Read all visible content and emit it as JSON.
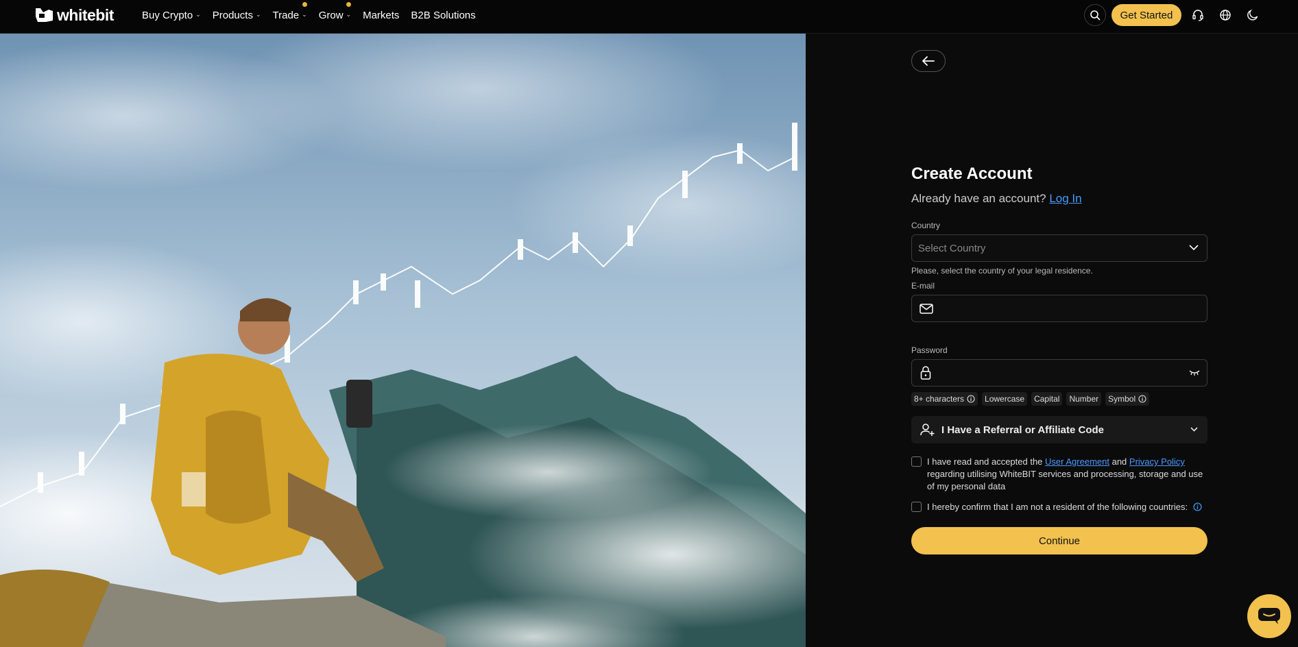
{
  "header": {
    "logo_text": "whitebit",
    "nav": [
      {
        "label": "Buy Crypto",
        "dropdown": true,
        "dot": false
      },
      {
        "label": "Products",
        "dropdown": true,
        "dot": false
      },
      {
        "label": "Trade",
        "dropdown": true,
        "dot": true
      },
      {
        "label": "Grow",
        "dropdown": true,
        "dot": true
      },
      {
        "label": "Markets",
        "dropdown": false,
        "dot": false
      },
      {
        "label": "B2B Solutions",
        "dropdown": false,
        "dot": false
      }
    ],
    "get_started_label": "Get Started",
    "icons": [
      "search-icon",
      "headset-icon",
      "globe-icon",
      "moon-icon"
    ]
  },
  "form": {
    "title": "Create Account",
    "subtitle_prefix": "Already have an account?",
    "login_link": "Log In",
    "country_label": "Country",
    "country_placeholder": "Select Country",
    "country_hint": "Please, select the country of your legal residence.",
    "email_label": "E-mail",
    "email_value": "",
    "password_label": "Password",
    "password_value": "",
    "password_rules": [
      "8+ characters",
      "Lowercase",
      "Capital",
      "Number",
      "Symbol"
    ],
    "referral_label": "I Have a Referral or Affiliate Code",
    "agreement_prefix": "I have read and accepted the",
    "user_agreement": "User Agreement",
    "agreement_and": "and",
    "privacy_policy": "Privacy Policy",
    "agreement_suffix": "regarding utilising WhiteBIT services and processing, storage and use of my personal data",
    "residency_text": "I hereby confirm that I am not a resident of the following countries:",
    "continue_label": "Continue"
  },
  "colors": {
    "accent": "#f2c14e",
    "link": "#4a9bff",
    "background": "#0b0b0b"
  }
}
